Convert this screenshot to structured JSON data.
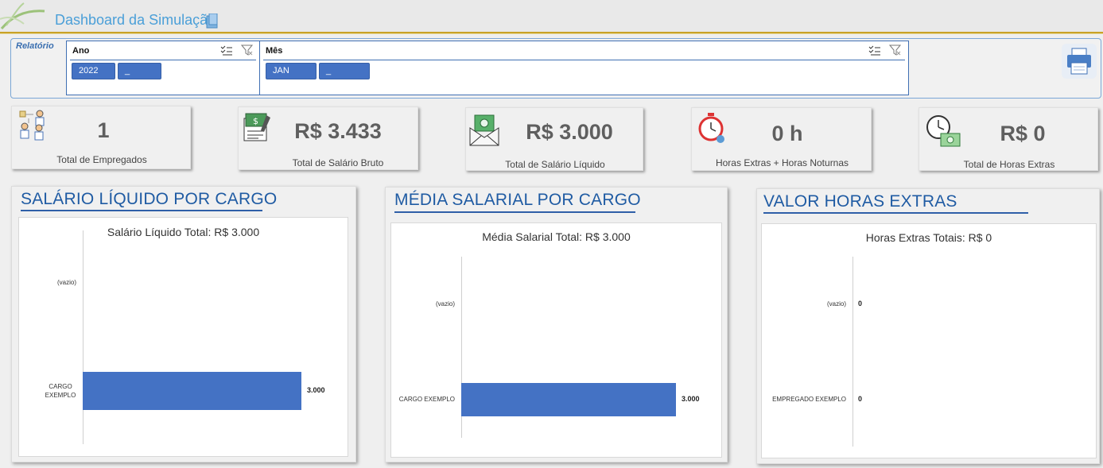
{
  "header": {
    "title": "Dashboard da Simulação"
  },
  "filter": {
    "label": "Relatório",
    "ano": {
      "title": "Ano",
      "items": [
        "2022",
        "_"
      ]
    },
    "mes": {
      "title": "Mês",
      "items": [
        "JAN",
        "_"
      ]
    }
  },
  "kpis": [
    {
      "value": "1",
      "label": "Total de Empregados",
      "icon": "team-icon"
    },
    {
      "value": "R$ 3.433",
      "label": "Total de Salário Bruto",
      "icon": "paycheck-icon"
    },
    {
      "value": "R$ 3.000",
      "label": "Total de Salário Líquido",
      "icon": "money-envelope-icon"
    },
    {
      "value": "0 h",
      "label": "Horas Extras + Horas Noturnas",
      "icon": "stopwatch-icon"
    },
    {
      "value": "R$ 0",
      "label": "Total de Horas Extras",
      "icon": "clock-money-icon"
    }
  ],
  "panels": {
    "salario": {
      "title": "SALÁRIO LÍQUIDO POR CARGO"
    },
    "media": {
      "title": "MÉDIA SALARIAL POR CARGO"
    },
    "horas": {
      "title": "VALOR HORAS EXTRAS"
    }
  },
  "chart_data": [
    {
      "type": "bar",
      "orientation": "horizontal",
      "title": "Salário Líquido Total: R$ 3.000",
      "categories": [
        "(vazio)",
        "CARGO EXEMPLO"
      ],
      "values": [
        0,
        3000
      ],
      "data_labels": [
        "",
        "3.000"
      ],
      "color": "#4472c4"
    },
    {
      "type": "bar",
      "orientation": "horizontal",
      "title": "Média Salarial Total: R$ 3.000",
      "categories": [
        "(vazio)",
        "CARGO EXEMPLO"
      ],
      "values": [
        0,
        3000
      ],
      "data_labels": [
        "",
        "3.000"
      ],
      "color": "#4472c4"
    },
    {
      "type": "bar",
      "orientation": "horizontal",
      "title": "Horas Extras Totais: R$ 0",
      "categories": [
        "(vazio)",
        "EMPREGADO EXEMPLO"
      ],
      "values": [
        0,
        0
      ],
      "data_labels": [
        "0",
        "0"
      ],
      "color": "#4472c4"
    }
  ]
}
